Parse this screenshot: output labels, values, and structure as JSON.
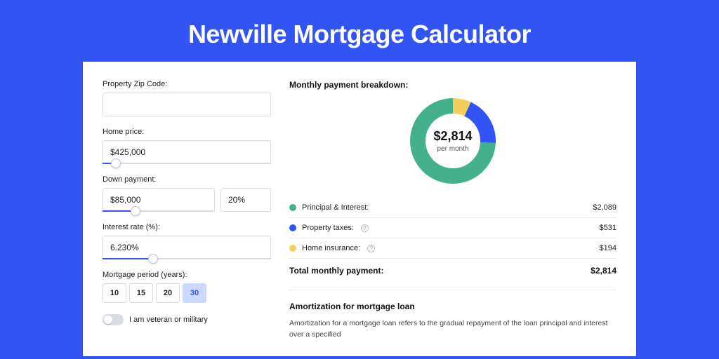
{
  "title": "Newville Mortgage Calculator",
  "form": {
    "zip_label": "Property Zip Code:",
    "zip_value": "",
    "home_price_label": "Home price:",
    "home_price_value": "$425,000",
    "home_price_slider_pct": 8,
    "down_payment_label": "Down payment:",
    "down_payment_value": "$85,000",
    "down_payment_pct_value": "20%",
    "down_payment_slider_pct": 20,
    "interest_label": "Interest rate (%):",
    "interest_value": "6.230%",
    "interest_slider_pct": 30,
    "period_label": "Mortgage period (years):",
    "periods": [
      "10",
      "15",
      "20",
      "30"
    ],
    "period_selected_index": 3,
    "veteran_label": "I am veteran or military",
    "veteran_checked": false
  },
  "breakdown": {
    "heading": "Monthly payment breakdown:",
    "center_value": "$2,814",
    "center_sub": "per month",
    "items": [
      {
        "label": "Principal & Interest:",
        "value": "$2,089",
        "color": "#44b08c",
        "info": false
      },
      {
        "label": "Property taxes:",
        "value": "$531",
        "color": "#3254f4",
        "info": true
      },
      {
        "label": "Home insurance:",
        "value": "$194",
        "color": "#f5cf5e",
        "info": true
      }
    ],
    "total_label": "Total monthly payment:",
    "total_value": "$2,814"
  },
  "amortization": {
    "title": "Amortization for mortgage loan",
    "text": "Amortization for a mortgage loan refers to the gradual repayment of the loan principal and interest over a specified"
  },
  "chart_data": {
    "type": "pie",
    "title": "Monthly payment breakdown",
    "series": [
      {
        "name": "Principal & Interest",
        "value": 2089,
        "color": "#44b08c"
      },
      {
        "name": "Property taxes",
        "value": 531,
        "color": "#3254f4"
      },
      {
        "name": "Home insurance",
        "value": 194,
        "color": "#f5cf5e"
      }
    ],
    "total": 2814,
    "inner_radius_ratio": 0.64
  }
}
